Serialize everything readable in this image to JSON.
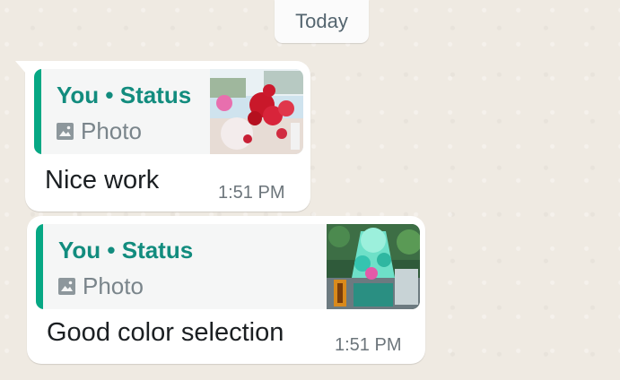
{
  "date_chip": "Today",
  "messages": [
    {
      "quote_title": "You • Status",
      "quote_type": "Photo",
      "quote_icon": "photo-icon",
      "text": "Nice work",
      "time": "1:51 PM"
    },
    {
      "quote_title": "You • Status",
      "quote_type": "Photo",
      "quote_icon": "photo-icon",
      "text": "Good color selection",
      "time": "1:51 PM"
    }
  ],
  "colors": {
    "accent_bar": "#06a884",
    "quote_title": "#128c7e",
    "bubble": "#ffffff",
    "wallpaper": "#efeae2"
  }
}
